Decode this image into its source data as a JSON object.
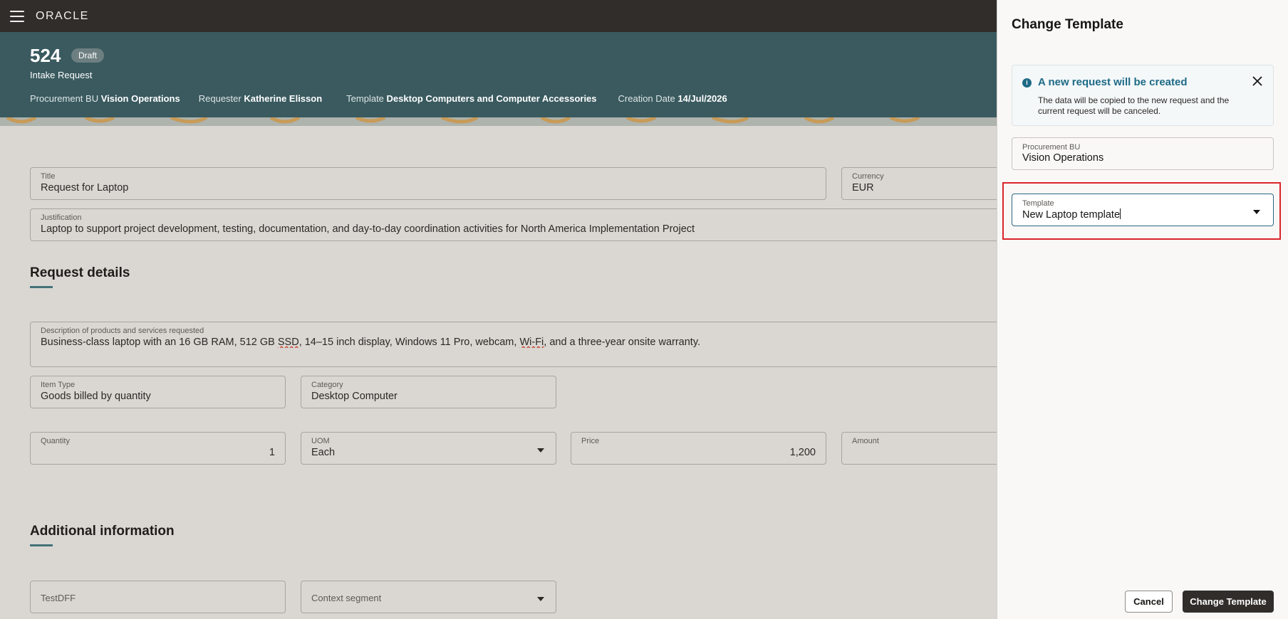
{
  "topbar": {
    "logo": "ORACLE"
  },
  "header": {
    "number": "524",
    "status": "Draft",
    "type": "Intake Request",
    "meta": [
      {
        "label": "Procurement BU",
        "value": "Vision Operations"
      },
      {
        "label": "Requester",
        "value": "Katherine Elisson"
      },
      {
        "label": "Template",
        "value": "Desktop Computers and Computer Accessories"
      },
      {
        "label": "Creation Date",
        "value": "14/Jul/2026"
      }
    ]
  },
  "form": {
    "title": {
      "label": "Title",
      "value": "Request for Laptop"
    },
    "currency": {
      "label": "Currency",
      "value": "EUR"
    },
    "justification": {
      "label": "Justification",
      "value": "Laptop to support project development, testing, documentation, and day-to-day coordination activities for North America Implementation Project"
    },
    "request_details_heading": "Request details",
    "description": {
      "label": "Description of products and services requested",
      "value_part1": "Business-class laptop with an 16 GB RAM, 512 GB ",
      "value_ssd": "SSD",
      "value_part2": ", 14–15 inch display, Windows 11 Pro, webcam, ",
      "value_wifi": "Wi-Fi",
      "value_part3": ", and a three-year onsite warranty."
    },
    "item_type": {
      "label": "Item Type",
      "value": "Goods billed by quantity"
    },
    "category": {
      "label": "Category",
      "value": "Desktop Computer"
    },
    "quantity": {
      "label": "Quantity",
      "value": "1"
    },
    "uom": {
      "label": "UOM",
      "value": "Each"
    },
    "price": {
      "label": "Price",
      "value": "1,200"
    },
    "amount": {
      "label": "Amount",
      "value": ""
    },
    "additional_info_heading": "Additional information",
    "testdff": {
      "placeholder": "TestDFF"
    },
    "context_segment": {
      "placeholder": "Context segment"
    }
  },
  "drawer": {
    "title": "Change Template",
    "notice": {
      "title": "A new request will be created",
      "text": "The data will be copied to the new request and the current request will be canceled."
    },
    "procurement_bu": {
      "label": "Procurement BU",
      "value": "Vision Operations"
    },
    "template": {
      "label": "Template",
      "value": "New Laptop template"
    },
    "cancel_label": "Cancel",
    "change_label": "Change Template"
  },
  "colors": {
    "accent": "#3a5a5f",
    "info": "#1e6a86",
    "highlight": "#d9242a",
    "primary_button": "#312d2a"
  }
}
